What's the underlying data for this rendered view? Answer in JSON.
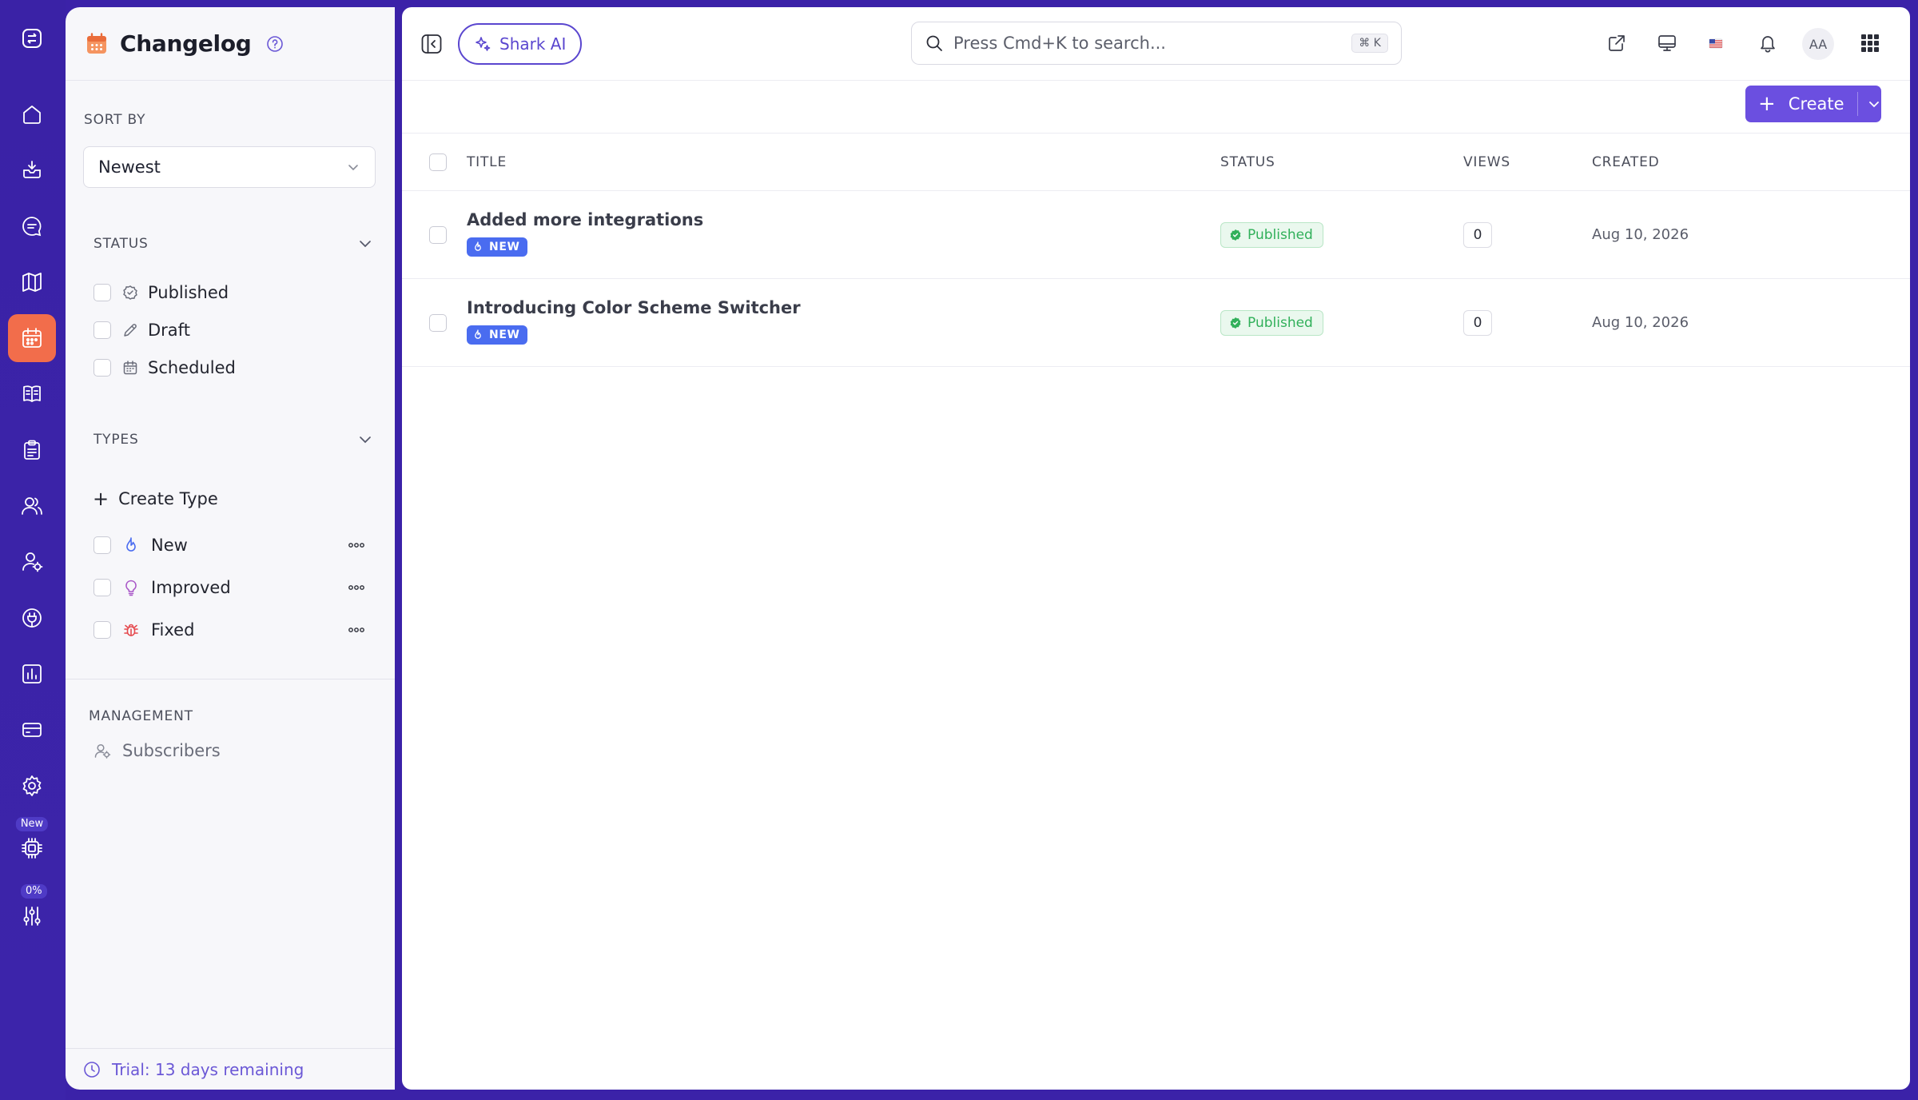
{
  "colors": {
    "rail": "#3b22a8",
    "accent": "#6b4fe0",
    "active_rail": "#f26d4b",
    "published_green": "#31b05a",
    "new_tag": "#4a6cf0"
  },
  "rail": {
    "items": [
      {
        "icon": "logo-icon"
      },
      {
        "icon": "home-icon"
      },
      {
        "icon": "inbox-icon"
      },
      {
        "icon": "chat-icon"
      },
      {
        "icon": "roadmap-icon"
      },
      {
        "icon": "changelog-calendar-icon",
        "active": true
      },
      {
        "icon": "knowledge-book-icon"
      },
      {
        "icon": "clipboard-icon"
      },
      {
        "icon": "users-icon"
      },
      {
        "icon": "user-settings-icon"
      },
      {
        "icon": "integrations-icon"
      },
      {
        "icon": "analytics-icon"
      },
      {
        "icon": "billing-card-icon"
      },
      {
        "icon": "settings-gear-icon"
      },
      {
        "icon": "ai-chip-icon",
        "badge": "New"
      },
      {
        "icon": "sliders-icon",
        "badge": "0%"
      }
    ]
  },
  "panel": {
    "title": "Changelog",
    "sort_by_label": "SORT BY",
    "sort_value": "Newest",
    "status_label": "STATUS",
    "status_options": [
      "Published",
      "Draft",
      "Scheduled"
    ],
    "types_label": "TYPES",
    "create_type": "Create Type",
    "types": [
      {
        "label": "New",
        "icon": "flame-icon",
        "color": "#4a6cf0"
      },
      {
        "label": "Improved",
        "icon": "lightbulb-icon",
        "color": "#a855c7"
      },
      {
        "label": "Fixed",
        "icon": "bug-icon",
        "color": "#e5484d"
      }
    ],
    "management_label": "MANAGEMENT",
    "subscribers": "Subscribers",
    "trial": "Trial: 13 days remaining"
  },
  "topbar": {
    "ai_label": "Shark AI",
    "search_placeholder": "Press Cmd+K to search...",
    "search_shortcut": "⌘ K",
    "avatar_initials": "AA"
  },
  "toolbar": {
    "create_label": "Create"
  },
  "table": {
    "headers": {
      "title": "TITLE",
      "status": "STATUS",
      "views": "VIEWS",
      "created": "CREATED"
    },
    "rows": [
      {
        "title": "Added more integrations",
        "tag": "NEW",
        "status": "Published",
        "views": "0",
        "created": "Aug 10, 2026"
      },
      {
        "title": "Introducing Color Scheme Switcher",
        "tag": "NEW",
        "status": "Published",
        "views": "0",
        "created": "Aug 10, 2026"
      }
    ]
  }
}
